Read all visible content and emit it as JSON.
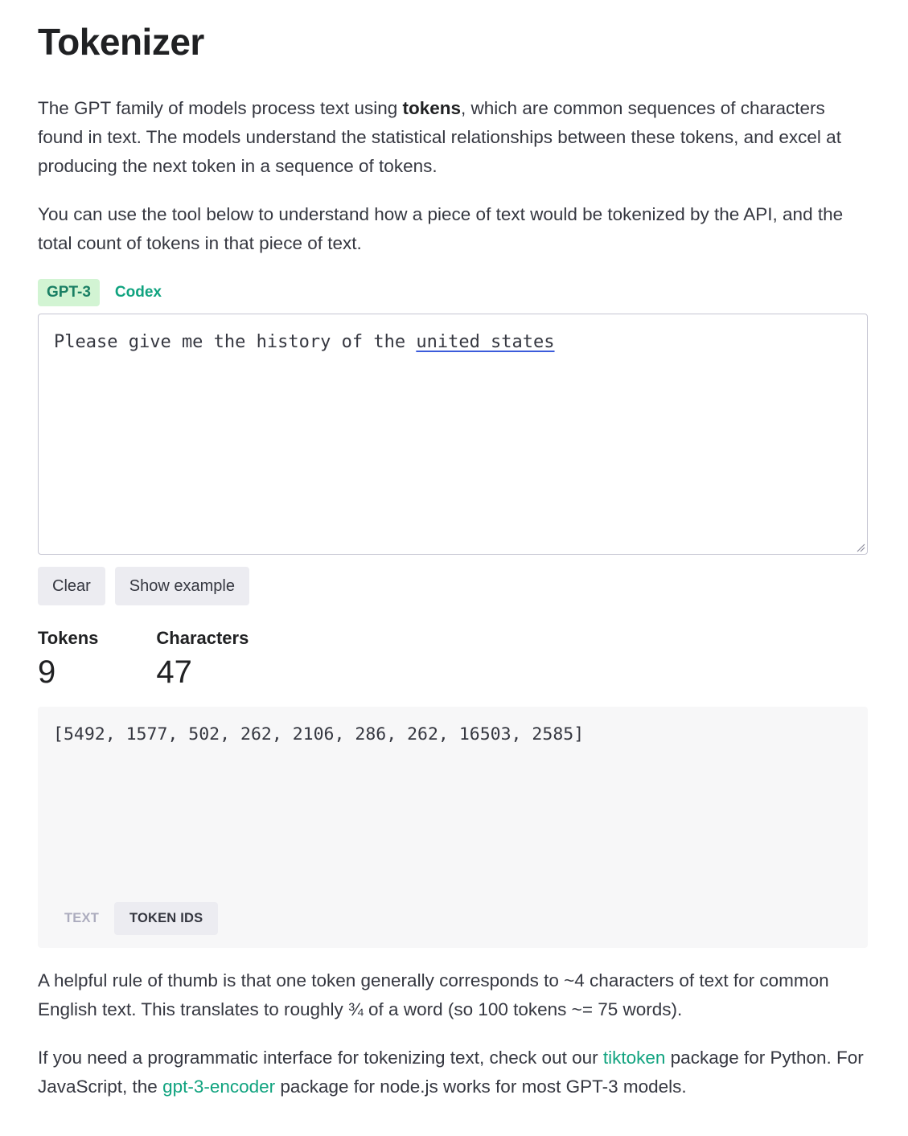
{
  "page": {
    "title": "Tokenizer",
    "intro": {
      "before_bold": "The GPT family of models process text using ",
      "bold": "tokens",
      "after_bold": ", which are common sequences of characters found in text. The models understand the statistical relationships between these tokens, and excel at producing the next token in a sequence of tokens."
    },
    "intro2": "You can use the tool below to understand how a piece of text would be tokenized by the API, and the total count of tokens in that piece of text."
  },
  "model_tabs": [
    {
      "label": "GPT-3",
      "active": true
    },
    {
      "label": "Codex",
      "active": false
    }
  ],
  "editor": {
    "text_before": "Please give me the history of the ",
    "text_flagged": "united states"
  },
  "buttons": {
    "clear": "Clear",
    "show_example": "Show example"
  },
  "stats": {
    "tokens_label": "Tokens",
    "tokens_value": "9",
    "characters_label": "Characters",
    "characters_value": "47"
  },
  "output": {
    "token_ids": "[5492, 1577, 502, 262, 2106, 286, 262, 16503, 2585]",
    "view_tabs": [
      {
        "label": "TEXT",
        "active": false
      },
      {
        "label": "TOKEN IDS",
        "active": true
      }
    ]
  },
  "footer": {
    "rule_of_thumb": "A helpful rule of thumb is that one token generally corresponds to ~4 characters of text for common English text. This translates to roughly ¾ of a word (so 100 tokens ~= 75 words).",
    "prog": {
      "part1": "If you need a programmatic interface for tokenizing text, check out our ",
      "link1": "tiktoken",
      "part2": " package for Python. For JavaScript, the ",
      "link2": "gpt-3-encoder",
      "part3": " package for node.js works for most GPT-3 models."
    }
  },
  "colors": {
    "accent": "#10a37f",
    "active_tab_bg": "#d2f4d3",
    "button_bg": "#ececf1",
    "output_bg": "#f7f7f8"
  }
}
